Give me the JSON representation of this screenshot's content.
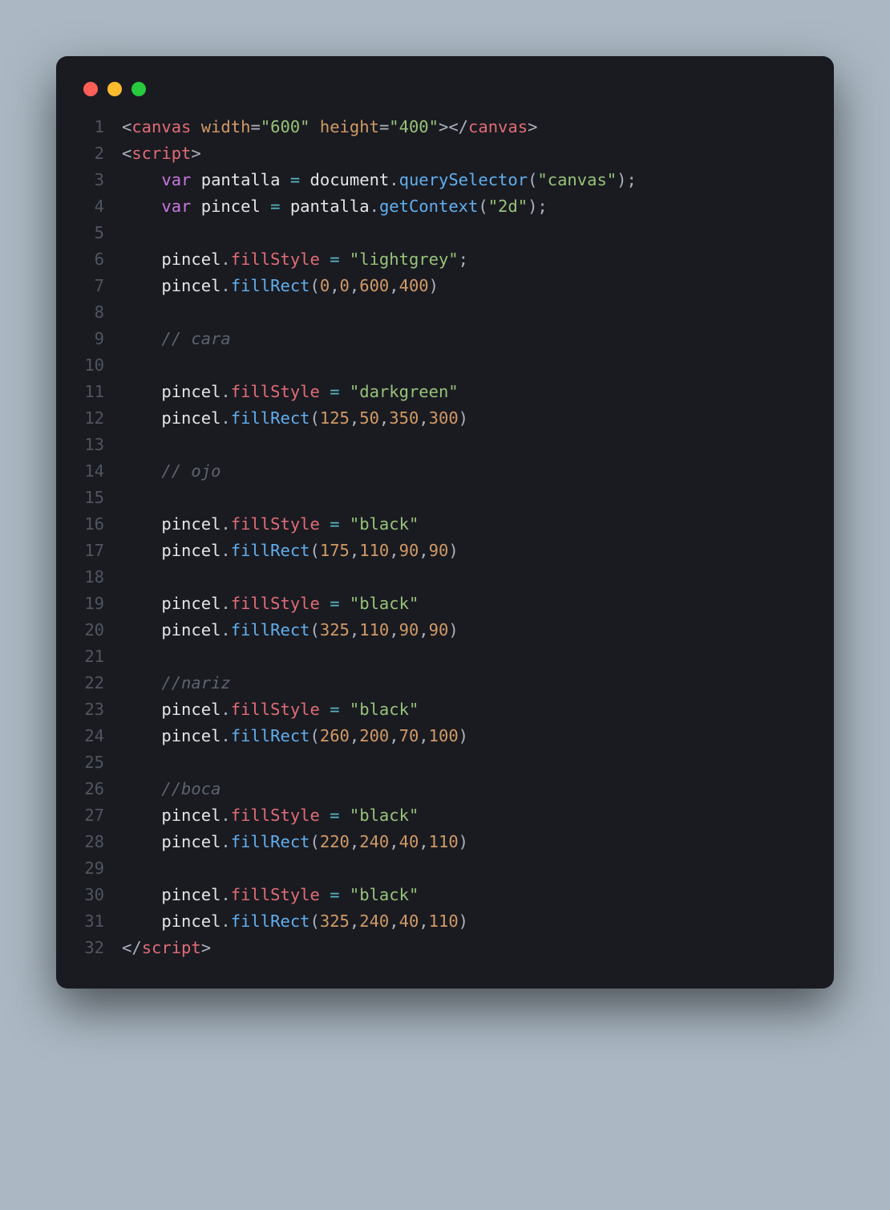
{
  "window": {
    "dots": [
      "red",
      "yellow",
      "green"
    ]
  },
  "code": {
    "lines": [
      {
        "n": "1",
        "tokens": [
          {
            "c": "ang",
            "t": "<"
          },
          {
            "c": "tag",
            "t": "canvas"
          },
          {
            "c": "ident",
            "t": " "
          },
          {
            "c": "attr",
            "t": "width"
          },
          {
            "c": "punc",
            "t": "="
          },
          {
            "c": "str",
            "t": "\"600\""
          },
          {
            "c": "ident",
            "t": " "
          },
          {
            "c": "attr",
            "t": "height"
          },
          {
            "c": "punc",
            "t": "="
          },
          {
            "c": "str",
            "t": "\"400\""
          },
          {
            "c": "ang",
            "t": "></"
          },
          {
            "c": "tag",
            "t": "canvas"
          },
          {
            "c": "ang",
            "t": ">"
          }
        ]
      },
      {
        "n": "2",
        "tokens": [
          {
            "c": "ang",
            "t": "<"
          },
          {
            "c": "tag",
            "t": "script"
          },
          {
            "c": "ang",
            "t": ">"
          }
        ]
      },
      {
        "n": "3",
        "tokens": [
          {
            "c": "ident",
            "t": "    "
          },
          {
            "c": "kw",
            "t": "var"
          },
          {
            "c": "ident",
            "t": " pantalla "
          },
          {
            "c": "op",
            "t": "="
          },
          {
            "c": "ident",
            "t": " document"
          },
          {
            "c": "dot-op",
            "t": "."
          },
          {
            "c": "func",
            "t": "querySelector"
          },
          {
            "c": "punc",
            "t": "("
          },
          {
            "c": "str",
            "t": "\"canvas\""
          },
          {
            "c": "punc",
            "t": ");"
          }
        ]
      },
      {
        "n": "4",
        "tokens": [
          {
            "c": "ident",
            "t": "    "
          },
          {
            "c": "kw",
            "t": "var"
          },
          {
            "c": "ident",
            "t": " pincel "
          },
          {
            "c": "op",
            "t": "="
          },
          {
            "c": "ident",
            "t": " pantalla"
          },
          {
            "c": "dot-op",
            "t": "."
          },
          {
            "c": "func",
            "t": "getContext"
          },
          {
            "c": "punc",
            "t": "("
          },
          {
            "c": "str",
            "t": "\"2d\""
          },
          {
            "c": "punc",
            "t": ");"
          }
        ]
      },
      {
        "n": "5",
        "tokens": [
          {
            "c": "ident",
            "t": " "
          }
        ]
      },
      {
        "n": "6",
        "tokens": [
          {
            "c": "ident",
            "t": "    pincel"
          },
          {
            "c": "dot-op",
            "t": "."
          },
          {
            "c": "prop",
            "t": "fillStyle"
          },
          {
            "c": "ident",
            "t": " "
          },
          {
            "c": "op",
            "t": "="
          },
          {
            "c": "ident",
            "t": " "
          },
          {
            "c": "str",
            "t": "\"lightgrey\""
          },
          {
            "c": "punc",
            "t": ";"
          }
        ]
      },
      {
        "n": "7",
        "tokens": [
          {
            "c": "ident",
            "t": "    pincel"
          },
          {
            "c": "dot-op",
            "t": "."
          },
          {
            "c": "func",
            "t": "fillRect"
          },
          {
            "c": "punc",
            "t": "("
          },
          {
            "c": "num",
            "t": "0"
          },
          {
            "c": "punc",
            "t": ","
          },
          {
            "c": "num",
            "t": "0"
          },
          {
            "c": "punc",
            "t": ","
          },
          {
            "c": "num",
            "t": "600"
          },
          {
            "c": "punc",
            "t": ","
          },
          {
            "c": "num",
            "t": "400"
          },
          {
            "c": "punc",
            "t": ")"
          }
        ]
      },
      {
        "n": "8",
        "tokens": [
          {
            "c": "ident",
            "t": " "
          }
        ]
      },
      {
        "n": "9",
        "tokens": [
          {
            "c": "ident",
            "t": "    "
          },
          {
            "c": "comm",
            "t": "// cara"
          }
        ]
      },
      {
        "n": "10",
        "tokens": [
          {
            "c": "ident",
            "t": " "
          }
        ]
      },
      {
        "n": "11",
        "tokens": [
          {
            "c": "ident",
            "t": "    pincel"
          },
          {
            "c": "dot-op",
            "t": "."
          },
          {
            "c": "prop",
            "t": "fillStyle"
          },
          {
            "c": "ident",
            "t": " "
          },
          {
            "c": "op",
            "t": "="
          },
          {
            "c": "ident",
            "t": " "
          },
          {
            "c": "str",
            "t": "\"darkgreen\""
          }
        ]
      },
      {
        "n": "12",
        "tokens": [
          {
            "c": "ident",
            "t": "    pincel"
          },
          {
            "c": "dot-op",
            "t": "."
          },
          {
            "c": "func",
            "t": "fillRect"
          },
          {
            "c": "punc",
            "t": "("
          },
          {
            "c": "num",
            "t": "125"
          },
          {
            "c": "punc",
            "t": ","
          },
          {
            "c": "num",
            "t": "50"
          },
          {
            "c": "punc",
            "t": ","
          },
          {
            "c": "num",
            "t": "350"
          },
          {
            "c": "punc",
            "t": ","
          },
          {
            "c": "num",
            "t": "300"
          },
          {
            "c": "punc",
            "t": ")"
          }
        ]
      },
      {
        "n": "13",
        "tokens": [
          {
            "c": "ident",
            "t": " "
          }
        ]
      },
      {
        "n": "14",
        "tokens": [
          {
            "c": "ident",
            "t": "    "
          },
          {
            "c": "comm",
            "t": "// ojo"
          }
        ]
      },
      {
        "n": "15",
        "tokens": [
          {
            "c": "ident",
            "t": " "
          }
        ]
      },
      {
        "n": "16",
        "tokens": [
          {
            "c": "ident",
            "t": "    pincel"
          },
          {
            "c": "dot-op",
            "t": "."
          },
          {
            "c": "prop",
            "t": "fillStyle"
          },
          {
            "c": "ident",
            "t": " "
          },
          {
            "c": "op",
            "t": "="
          },
          {
            "c": "ident",
            "t": " "
          },
          {
            "c": "str",
            "t": "\"black\""
          }
        ]
      },
      {
        "n": "17",
        "tokens": [
          {
            "c": "ident",
            "t": "    pincel"
          },
          {
            "c": "dot-op",
            "t": "."
          },
          {
            "c": "func",
            "t": "fillRect"
          },
          {
            "c": "punc",
            "t": "("
          },
          {
            "c": "num",
            "t": "175"
          },
          {
            "c": "punc",
            "t": ","
          },
          {
            "c": "num",
            "t": "110"
          },
          {
            "c": "punc",
            "t": ","
          },
          {
            "c": "num",
            "t": "90"
          },
          {
            "c": "punc",
            "t": ","
          },
          {
            "c": "num",
            "t": "90"
          },
          {
            "c": "punc",
            "t": ")"
          }
        ]
      },
      {
        "n": "18",
        "tokens": [
          {
            "c": "ident",
            "t": " "
          }
        ]
      },
      {
        "n": "19",
        "tokens": [
          {
            "c": "ident",
            "t": "    pincel"
          },
          {
            "c": "dot-op",
            "t": "."
          },
          {
            "c": "prop",
            "t": "fillStyle"
          },
          {
            "c": "ident",
            "t": " "
          },
          {
            "c": "op",
            "t": "="
          },
          {
            "c": "ident",
            "t": " "
          },
          {
            "c": "str",
            "t": "\"black\""
          }
        ]
      },
      {
        "n": "20",
        "tokens": [
          {
            "c": "ident",
            "t": "    pincel"
          },
          {
            "c": "dot-op",
            "t": "."
          },
          {
            "c": "func",
            "t": "fillRect"
          },
          {
            "c": "punc",
            "t": "("
          },
          {
            "c": "num",
            "t": "325"
          },
          {
            "c": "punc",
            "t": ","
          },
          {
            "c": "num",
            "t": "110"
          },
          {
            "c": "punc",
            "t": ","
          },
          {
            "c": "num",
            "t": "90"
          },
          {
            "c": "punc",
            "t": ","
          },
          {
            "c": "num",
            "t": "90"
          },
          {
            "c": "punc",
            "t": ")"
          }
        ]
      },
      {
        "n": "21",
        "tokens": [
          {
            "c": "ident",
            "t": " "
          }
        ]
      },
      {
        "n": "22",
        "tokens": [
          {
            "c": "ident",
            "t": "    "
          },
          {
            "c": "comm",
            "t": "//nariz"
          }
        ]
      },
      {
        "n": "23",
        "tokens": [
          {
            "c": "ident",
            "t": "    pincel"
          },
          {
            "c": "dot-op",
            "t": "."
          },
          {
            "c": "prop",
            "t": "fillStyle"
          },
          {
            "c": "ident",
            "t": " "
          },
          {
            "c": "op",
            "t": "="
          },
          {
            "c": "ident",
            "t": " "
          },
          {
            "c": "str",
            "t": "\"black\""
          }
        ]
      },
      {
        "n": "24",
        "tokens": [
          {
            "c": "ident",
            "t": "    pincel"
          },
          {
            "c": "dot-op",
            "t": "."
          },
          {
            "c": "func",
            "t": "fillRect"
          },
          {
            "c": "punc",
            "t": "("
          },
          {
            "c": "num",
            "t": "260"
          },
          {
            "c": "punc",
            "t": ","
          },
          {
            "c": "num",
            "t": "200"
          },
          {
            "c": "punc",
            "t": ","
          },
          {
            "c": "num",
            "t": "70"
          },
          {
            "c": "punc",
            "t": ","
          },
          {
            "c": "num",
            "t": "100"
          },
          {
            "c": "punc",
            "t": ")"
          }
        ]
      },
      {
        "n": "25",
        "tokens": [
          {
            "c": "ident",
            "t": " "
          }
        ]
      },
      {
        "n": "26",
        "tokens": [
          {
            "c": "ident",
            "t": "    "
          },
          {
            "c": "comm",
            "t": "//boca"
          }
        ]
      },
      {
        "n": "27",
        "tokens": [
          {
            "c": "ident",
            "t": "    pincel"
          },
          {
            "c": "dot-op",
            "t": "."
          },
          {
            "c": "prop",
            "t": "fillStyle"
          },
          {
            "c": "ident",
            "t": " "
          },
          {
            "c": "op",
            "t": "="
          },
          {
            "c": "ident",
            "t": " "
          },
          {
            "c": "str",
            "t": "\"black\""
          }
        ]
      },
      {
        "n": "28",
        "tokens": [
          {
            "c": "ident",
            "t": "    pincel"
          },
          {
            "c": "dot-op",
            "t": "."
          },
          {
            "c": "func",
            "t": "fillRect"
          },
          {
            "c": "punc",
            "t": "("
          },
          {
            "c": "num",
            "t": "220"
          },
          {
            "c": "punc",
            "t": ","
          },
          {
            "c": "num",
            "t": "240"
          },
          {
            "c": "punc",
            "t": ","
          },
          {
            "c": "num",
            "t": "40"
          },
          {
            "c": "punc",
            "t": ","
          },
          {
            "c": "num",
            "t": "110"
          },
          {
            "c": "punc",
            "t": ")"
          }
        ]
      },
      {
        "n": "29",
        "tokens": [
          {
            "c": "ident",
            "t": " "
          }
        ]
      },
      {
        "n": "30",
        "tokens": [
          {
            "c": "ident",
            "t": "    pincel"
          },
          {
            "c": "dot-op",
            "t": "."
          },
          {
            "c": "prop",
            "t": "fillStyle"
          },
          {
            "c": "ident",
            "t": " "
          },
          {
            "c": "op",
            "t": "="
          },
          {
            "c": "ident",
            "t": " "
          },
          {
            "c": "str",
            "t": "\"black\""
          }
        ]
      },
      {
        "n": "31",
        "tokens": [
          {
            "c": "ident",
            "t": "    pincel"
          },
          {
            "c": "dot-op",
            "t": "."
          },
          {
            "c": "func",
            "t": "fillRect"
          },
          {
            "c": "punc",
            "t": "("
          },
          {
            "c": "num",
            "t": "325"
          },
          {
            "c": "punc",
            "t": ","
          },
          {
            "c": "num",
            "t": "240"
          },
          {
            "c": "punc",
            "t": ","
          },
          {
            "c": "num",
            "t": "40"
          },
          {
            "c": "punc",
            "t": ","
          },
          {
            "c": "num",
            "t": "110"
          },
          {
            "c": "punc",
            "t": ")"
          }
        ]
      },
      {
        "n": "32",
        "tokens": [
          {
            "c": "ang",
            "t": "</"
          },
          {
            "c": "tag",
            "t": "script"
          },
          {
            "c": "ang",
            "t": ">"
          }
        ]
      }
    ]
  }
}
